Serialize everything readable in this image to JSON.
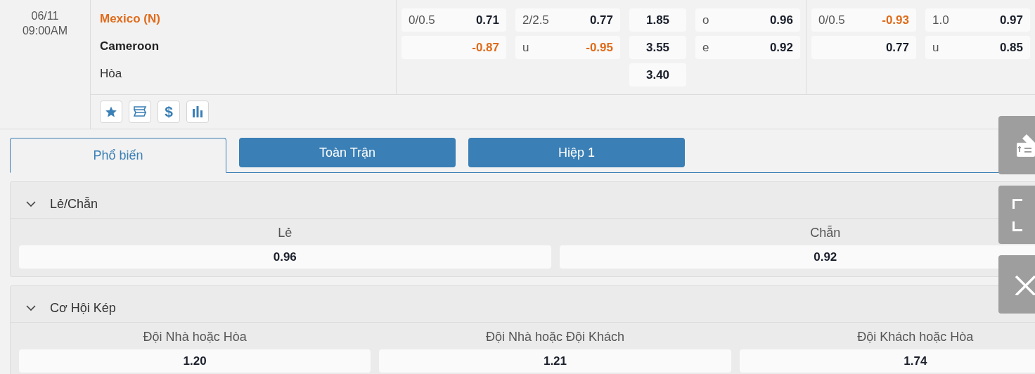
{
  "match": {
    "date": "06/11",
    "time": "09:00AM",
    "teams": [
      {
        "name": "Mexico (N)",
        "highlight": true
      },
      {
        "name": "Cameroon",
        "highlight": false
      }
    ],
    "draw_label": "Hòa",
    "odds_groups": [
      {
        "columns": [
          {
            "kind": "handicap",
            "cells": [
              {
                "label": "0/0.5",
                "value": "0.71",
                "negative": false
              },
              {
                "value": "-0.87",
                "negative": true
              }
            ]
          },
          {
            "kind": "handicap",
            "cells": [
              {
                "label": "2/2.5",
                "value": "0.77",
                "negative": false
              },
              {
                "label": "u",
                "value": "-0.95",
                "negative": true
              }
            ]
          },
          {
            "kind": "single",
            "cells": [
              {
                "value": "1.85",
                "negative": false
              },
              {
                "value": "3.55",
                "negative": false
              },
              {
                "value": "3.40",
                "negative": false
              }
            ]
          },
          {
            "kind": "handicap",
            "cells": [
              {
                "label": "o",
                "value": "0.96",
                "negative": false
              },
              {
                "label": "e",
                "value": "0.92",
                "negative": false
              }
            ]
          }
        ]
      },
      {
        "columns": [
          {
            "kind": "handicap",
            "cells": [
              {
                "label": "0/0.5",
                "value": "-0.93",
                "negative": true
              },
              {
                "value": "0.77",
                "negative": false
              }
            ]
          },
          {
            "kind": "handicap",
            "cells": [
              {
                "label": "1.0",
                "value": "0.97",
                "negative": false
              },
              {
                "label": "u",
                "value": "0.85",
                "negative": false
              }
            ]
          }
        ]
      }
    ],
    "toolbar": [
      {
        "kind": "favorite"
      },
      {
        "kind": "ticket"
      },
      {
        "kind": "money",
        "glyph": "$"
      },
      {
        "kind": "stats"
      }
    ]
  },
  "tabs": [
    {
      "label": "Phổ biến",
      "selected": true
    },
    {
      "label": "Toàn Trận",
      "selected": false
    },
    {
      "label": "Hiệp 1",
      "selected": false
    }
  ],
  "markets": [
    {
      "title": "Lẻ/Chẵn",
      "expanded": true,
      "options": [
        {
          "label": "Lẻ",
          "value": "0.96"
        },
        {
          "label": "Chẵn",
          "value": "0.92"
        }
      ]
    },
    {
      "title": "Cơ Hội Kép",
      "expanded": true,
      "options": [
        {
          "label": "Đội Nhà hoặc Hòa",
          "value": "1.20"
        },
        {
          "label": "Đội Nhà hoặc Đội Khách",
          "value": "1.21"
        },
        {
          "label": "Đội Khách hoặc Hòa",
          "value": "1.74"
        }
      ]
    }
  ],
  "side_buttons": [
    {
      "kind": "bet-slip"
    },
    {
      "kind": "fullscreen"
    },
    {
      "kind": "close"
    }
  ]
}
